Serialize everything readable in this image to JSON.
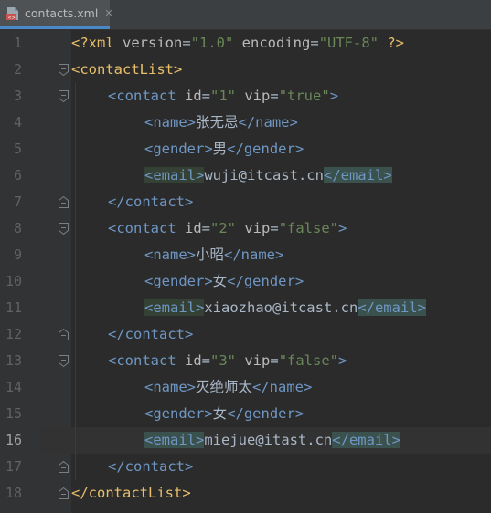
{
  "tab": {
    "filename": "contacts.xml",
    "icon": "xml-file-icon",
    "close_glyph": "✕"
  },
  "colors": {
    "background": "#2b2b2b",
    "tag_orange": "#e8bf6a",
    "tag_blue": "#6f97c4",
    "string_green": "#6a8759",
    "text": "#a9b7c6",
    "line_number": "#606366"
  },
  "editor": {
    "current_line": 16,
    "lines": [
      {
        "n": "1",
        "indent": 0,
        "fold": "",
        "segs": [
          [
            "<?xml ",
            "t-decl"
          ],
          [
            "version",
            "t-attr"
          ],
          [
            "=",
            "t-text"
          ],
          [
            "\"1.0\"",
            "t-val"
          ],
          [
            " encoding",
            "t-attr"
          ],
          [
            "=",
            "t-text"
          ],
          [
            "\"UTF-8\"",
            "t-val"
          ],
          [
            " ?>",
            "t-decl"
          ]
        ]
      },
      {
        "n": "2",
        "indent": 0,
        "fold": "open",
        "segs": [
          [
            "<contactList>",
            "t-tag"
          ]
        ]
      },
      {
        "n": "3",
        "indent": 1,
        "fold": "open",
        "segs": [
          [
            "<contact ",
            "t-ctag"
          ],
          [
            "id",
            "t-attr"
          ],
          [
            "=",
            "t-text"
          ],
          [
            "\"1\"",
            "t-val"
          ],
          [
            " vip",
            "t-attr"
          ],
          [
            "=",
            "t-text"
          ],
          [
            "\"true\"",
            "t-val"
          ],
          [
            ">",
            "t-ctag"
          ]
        ]
      },
      {
        "n": "4",
        "indent": 2,
        "fold": "",
        "segs": [
          [
            "<name>",
            "t-ctag"
          ],
          [
            "张无忌",
            "t-text"
          ],
          [
            "</name>",
            "t-ctag"
          ]
        ]
      },
      {
        "n": "5",
        "indent": 2,
        "fold": "",
        "segs": [
          [
            "<gender>",
            "t-ctag"
          ],
          [
            "男",
            "t-text"
          ],
          [
            "</gender>",
            "t-ctag"
          ]
        ]
      },
      {
        "n": "6",
        "indent": 2,
        "fold": "",
        "segs": [
          [
            "<email>",
            "t-ctag hl-left"
          ],
          [
            "wuji@itcast.cn",
            "t-text"
          ],
          [
            "</email>",
            "t-ctag hl-right"
          ]
        ]
      },
      {
        "n": "7",
        "indent": 1,
        "fold": "close",
        "segs": [
          [
            "</contact>",
            "t-ctag"
          ]
        ]
      },
      {
        "n": "8",
        "indent": 1,
        "fold": "open",
        "segs": [
          [
            "<contact ",
            "t-ctag"
          ],
          [
            "id",
            "t-attr"
          ],
          [
            "=",
            "t-text"
          ],
          [
            "\"2\"",
            "t-val"
          ],
          [
            " vip",
            "t-attr"
          ],
          [
            "=",
            "t-text"
          ],
          [
            "\"false\"",
            "t-val"
          ],
          [
            ">",
            "t-ctag"
          ]
        ]
      },
      {
        "n": "9",
        "indent": 2,
        "fold": "",
        "segs": [
          [
            "<name>",
            "t-ctag"
          ],
          [
            "小昭",
            "t-text"
          ],
          [
            "</name>",
            "t-ctag"
          ]
        ]
      },
      {
        "n": "10",
        "indent": 2,
        "fold": "",
        "segs": [
          [
            "<gender>",
            "t-ctag"
          ],
          [
            "女",
            "t-text"
          ],
          [
            "</gender>",
            "t-ctag"
          ]
        ]
      },
      {
        "n": "11",
        "indent": 2,
        "fold": "",
        "segs": [
          [
            "<email>",
            "t-ctag hl-left"
          ],
          [
            "xiaozhao@itcast.cn",
            "t-text"
          ],
          [
            "</email>",
            "t-ctag hl-right"
          ]
        ]
      },
      {
        "n": "12",
        "indent": 1,
        "fold": "close",
        "segs": [
          [
            "</contact>",
            "t-ctag"
          ]
        ]
      },
      {
        "n": "13",
        "indent": 1,
        "fold": "open",
        "segs": [
          [
            "<contact ",
            "t-ctag"
          ],
          [
            "id",
            "t-attr"
          ],
          [
            "=",
            "t-text"
          ],
          [
            "\"3\"",
            "t-val"
          ],
          [
            " vip",
            "t-attr"
          ],
          [
            "=",
            "t-text"
          ],
          [
            "\"false\"",
            "t-val"
          ],
          [
            ">",
            "t-ctag"
          ]
        ]
      },
      {
        "n": "14",
        "indent": 2,
        "fold": "",
        "segs": [
          [
            "<name>",
            "t-ctag"
          ],
          [
            "灭绝师太",
            "t-text"
          ],
          [
            "</name>",
            "t-ctag"
          ]
        ]
      },
      {
        "n": "15",
        "indent": 2,
        "fold": "",
        "segs": [
          [
            "<gender>",
            "t-ctag"
          ],
          [
            "女",
            "t-text"
          ],
          [
            "</gender>",
            "t-ctag"
          ]
        ]
      },
      {
        "n": "16",
        "indent": 2,
        "fold": "",
        "segs": [
          [
            "<email>",
            "t-ctag hl-match"
          ],
          [
            "miejue@itast.cn",
            "t-text"
          ],
          [
            "</email>",
            "t-ctag hl-match"
          ]
        ]
      },
      {
        "n": "17",
        "indent": 1,
        "fold": "close",
        "segs": [
          [
            "</contact>",
            "t-ctag"
          ]
        ]
      },
      {
        "n": "18",
        "indent": 0,
        "fold": "close",
        "segs": [
          [
            "</contactList>",
            "t-tag"
          ]
        ]
      }
    ]
  }
}
